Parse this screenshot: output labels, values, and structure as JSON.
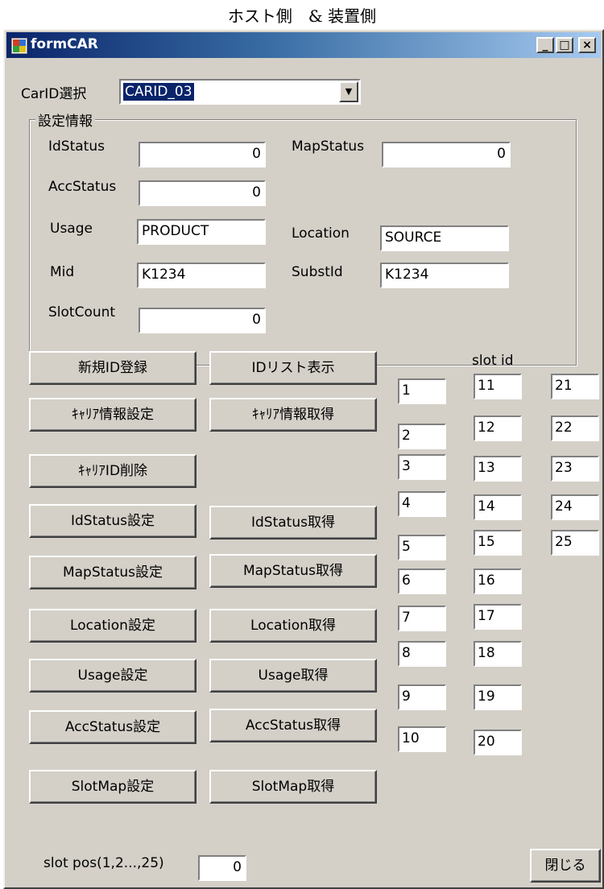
{
  "caption": "ホスト側　& 装置側",
  "window": {
    "title": "formCAR",
    "minimize": "_",
    "maximize": "□",
    "close": "×"
  },
  "carid": {
    "label": "CarID選択",
    "value": "CARID_03",
    "arrow": "▼"
  },
  "settings": {
    "title": "設定情報",
    "id_status": {
      "label": "IdStatus",
      "value": "0"
    },
    "map_status": {
      "label": "MapStatus",
      "value": "0"
    },
    "acc_status": {
      "label": "AccStatus",
      "value": "0"
    },
    "usage": {
      "label": "Usage",
      "value": "PRODUCT"
    },
    "location": {
      "label": "Location",
      "value": "SOURCE"
    },
    "mid": {
      "label": "Mid",
      "value": "K1234"
    },
    "subst_id": {
      "label": "SubstId",
      "value": "K1234"
    },
    "slot_count": {
      "label": "SlotCount",
      "value": "0"
    }
  },
  "buttons": {
    "new_id": "新規ID登録",
    "id_list": "IDリスト表示",
    "carrier_set": "ｷｬﾘｱ情報設定",
    "carrier_get": "ｷｬﾘｱ情報取得",
    "carrier_delete": "ｷｬﾘｱID削除",
    "idstatus_set": "IdStatus設定",
    "idstatus_get": "IdStatus取得",
    "mapstatus_set": "MapStatus設定",
    "mapstatus_get": "MapStatus取得",
    "location_set": "Location設定",
    "location_get": "Location取得",
    "usage_set": "Usage設定",
    "usage_get": "Usage取得",
    "accstatus_set": "AccStatus設定",
    "accstatus_get": "AccStatus取得",
    "slotmap_set": "SlotMap設定",
    "slotmap_get": "SlotMap取得",
    "close": "閉じる"
  },
  "slots": {
    "header": "slot id",
    "col1": [
      "1",
      "2",
      "3",
      "4",
      "5",
      "6",
      "7",
      "8",
      "9",
      "10"
    ],
    "col2": [
      "11",
      "12",
      "13",
      "14",
      "15",
      "16",
      "17",
      "18",
      "19",
      "20"
    ],
    "col3": [
      "21",
      "22",
      "23",
      "24",
      "25"
    ]
  },
  "slot_pos": {
    "label": "slot pos(1,2...,25)",
    "value": "0"
  }
}
